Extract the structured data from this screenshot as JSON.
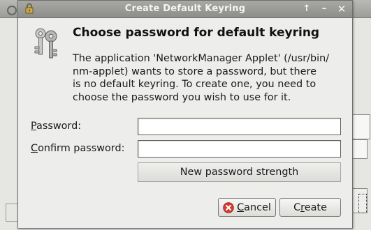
{
  "dialog": {
    "title": "Create Default Keyring",
    "heading": "Choose password for default keyring",
    "description_lines": [
      "The application 'NetworkManager Applet' (/usr/bin/",
      "nm-applet) wants to store a password, but there",
      "is no default keyring. To create one, you need to",
      "choose the password you wish to use for it."
    ]
  },
  "titlebar_buttons": {
    "roll_up": "↑",
    "minimize": "–",
    "close": "✕"
  },
  "form": {
    "password_label": {
      "mnemonic": "P",
      "rest": "assword:"
    },
    "confirm_label": {
      "mnemonic": "C",
      "rest": "onfirm password:"
    },
    "password_value": "",
    "confirm_value": "",
    "strength_label": "New password strength",
    "strength_fraction": 0
  },
  "buttons": {
    "cancel": {
      "mnemonic": "C",
      "rest": "ancel"
    },
    "create": {
      "first": "C",
      "mnemonic": "r",
      "rest": "eate"
    }
  },
  "icons": {
    "titlebar": "lock-icon",
    "dialog": "keys-icon",
    "cancel": "cancel-icon"
  },
  "colors": {
    "titlebar": "#9a9a97",
    "cancel_icon": "#d93b2f"
  }
}
